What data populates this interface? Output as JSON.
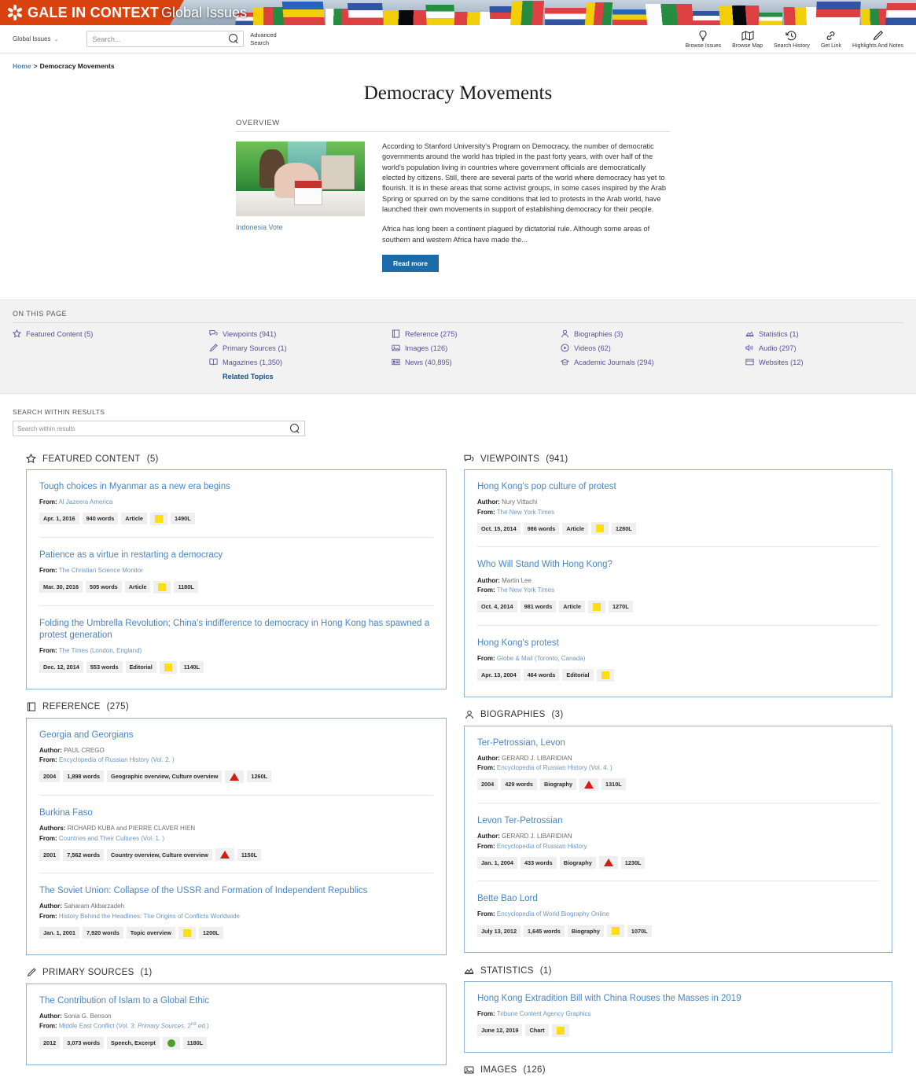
{
  "banner": {
    "brand": "GALE IN CONTEXT",
    "product": "Global Issues"
  },
  "toolbar": {
    "database_select": "Global Issues",
    "chevron": "⌄",
    "search_placeholder": "Search...",
    "search_value": "",
    "advanced_search": "Advanced Search",
    "tools": [
      {
        "label": "Browse Issues",
        "icon": "lightbulb-icon"
      },
      {
        "label": "Browse Map",
        "icon": "map-icon"
      },
      {
        "label": "Search History",
        "icon": "history-clock-icon"
      },
      {
        "label": "Get Link",
        "icon": "link-chain-icon"
      },
      {
        "label": "Highlights And Notes",
        "icon": "pencil-highlighter-icon"
      }
    ]
  },
  "breadcrumb": {
    "home": "Home",
    "separator": ">",
    "current": "Democracy Movements"
  },
  "page_title": "Democracy Movements",
  "overview": {
    "label": "OVERVIEW",
    "image_caption": "Indonesia Vote",
    "paragraph1": "According to Stanford University's Program on Democracy, the number of democratic governments around the world has tripled in the past forty years, with over half of the world's population living in countries where government officials are democratically elected by citizens. Still, there are several parts of the world where democracy has yet to flourish. It is in these areas that some activist groups, in some cases inspired by the Arab Spring or spurred on by the same conditions that led to protests in the Arab world, have launched their own movements in support of establishing democracy for their people.",
    "paragraph2": "Africa has long been a continent plagued by dictatorial rule. Although some areas of southern and western Africa have made the...",
    "read_more": "Read more"
  },
  "on_this_page": {
    "label": "ON THIS PAGE",
    "col1": [
      {
        "label": "Featured Content (5)",
        "icon": "star-icon"
      }
    ],
    "col2": [
      {
        "label": "Viewpoints (941)",
        "icon": "speech-bubbles-icon"
      },
      {
        "label": "Primary Sources (1)",
        "icon": "pencil-icon"
      },
      {
        "label": "Magazines (1,350)",
        "icon": "open-book-icon"
      }
    ],
    "related_topics": "Related Topics",
    "col3": [
      {
        "label": "Reference (275)",
        "icon": "book-icon"
      },
      {
        "label": "Images (126)",
        "icon": "picture-icon"
      },
      {
        "label": "News (40,895)",
        "icon": "newspaper-icon"
      }
    ],
    "col4": [
      {
        "label": "Biographies (3)",
        "icon": "person-icon"
      },
      {
        "label": "Videos (62)",
        "icon": "play-circle-icon"
      },
      {
        "label": "Academic Journals (294)",
        "icon": "graduation-cap-icon"
      }
    ],
    "col5": [
      {
        "label": "Statistics (1)",
        "icon": "chart-icon"
      },
      {
        "label": "Audio (297)",
        "icon": "speaker-icon"
      },
      {
        "label": "Websites (12)",
        "icon": "browser-window-icon"
      }
    ]
  },
  "search_within": {
    "label": "SEARCH WITHIN RESULTS",
    "placeholder": "Search within results",
    "value": ""
  },
  "sections": {
    "featured_content": {
      "title": "FEATURED CONTENT",
      "count": "(5)",
      "icon": "star-icon",
      "entries": [
        {
          "title": "Tough choices in Myanmar as a new era begins",
          "from_label": "From:",
          "from": "Al Jazeera America",
          "badges": [
            "Apr. 1, 2016",
            "940 words",
            "Article"
          ],
          "level": "yellow",
          "lexile": "1490L"
        },
        {
          "title": "Patience as a virtue in restarting a democracy",
          "from_label": "From:",
          "from": "The Christian Science Monitor",
          "badges": [
            "Mar. 30, 2016",
            "505 words",
            "Article"
          ],
          "level": "yellow",
          "lexile": "1180L"
        },
        {
          "title": "Folding the Umbrella Revolution; China's indifference to democracy in Hong Kong has spawned a protest generation",
          "from_label": "From:",
          "from": "The Times (London, England)",
          "badges": [
            "Dec. 12, 2014",
            "553 words",
            "Editorial"
          ],
          "level": "yellow",
          "lexile": "1140L"
        }
      ]
    },
    "viewpoints": {
      "title": "VIEWPOINTS",
      "count": "(941)",
      "icon": "speech-bubbles-icon",
      "entries": [
        {
          "title": "Hong Kong's pop culture of protest",
          "author_label": "Author:",
          "author": "Nury Vittachi",
          "from_label": "From:",
          "from": "The New York Times",
          "badges": [
            "Oct. 15, 2014",
            "986 words",
            "Article"
          ],
          "level": "yellow",
          "lexile": "1280L"
        },
        {
          "title": "Who Will Stand With Hong Kong?",
          "author_label": "Author:",
          "author": "Martin Lee",
          "from_label": "From:",
          "from": "The New York Times",
          "badges": [
            "Oct. 4, 2014",
            "981 words",
            "Article"
          ],
          "level": "yellow",
          "lexile": "1270L"
        },
        {
          "title": "Hong Kong's protest",
          "from_label": "From:",
          "from": "Globe & Mail (Toronto, Canada)",
          "badges": [
            "Apr. 13, 2004",
            "464 words",
            "Editorial"
          ],
          "level": "yellow",
          "lexile": ""
        }
      ]
    },
    "reference": {
      "title": "REFERENCE",
      "count": "(275)",
      "icon": "book-icon",
      "entries": [
        {
          "title": "Georgia and Georgians",
          "author_label": "Author:",
          "author": "PAUL CREGO",
          "from_label": "From:",
          "from": "Encyclopedia of Russian History (Vol. 2. )",
          "badges": [
            "2004",
            "1,898 words",
            "Geographic overview, Culture overview"
          ],
          "level": "red",
          "lexile": "1260L"
        },
        {
          "title": "Burkina Faso",
          "author_label": "Authors:",
          "author": "RICHARD KUBA and PIERRE CLAVER HIEN",
          "from_label": "From:",
          "from": "Countries and Their Cultures (Vol. 1. )",
          "badges": [
            "2001",
            "7,562 words",
            "Country overview, Culture overview"
          ],
          "level": "red",
          "lexile": "1150L"
        },
        {
          "title": "The Soviet Union: Collapse of the USSR and Formation of Independent Republics",
          "author_label": "Author:",
          "author": "Saharam Akbarzadeh",
          "from_label": "From:",
          "from": "History Behind the Headlines: The Origins of Conflicts Worldwide",
          "badges": [
            "Jan. 1, 2001",
            "7,920 words",
            "Topic overview"
          ],
          "level": "yellow",
          "lexile": "1200L"
        }
      ]
    },
    "biographies": {
      "title": "BIOGRAPHIES",
      "count": "(3)",
      "icon": "person-icon",
      "entries": [
        {
          "title": "Ter-Petrossian, Levon",
          "author_label": "Author:",
          "author": "GERARD J. LIBARIDIAN",
          "from_label": "From:",
          "from": "Encyclopedia of Russian History (Vol. 4. )",
          "badges": [
            "2004",
            "429 words",
            "Biography"
          ],
          "level": "red",
          "lexile": "1310L"
        },
        {
          "title": "Levon Ter-Petrossian",
          "author_label": "Author:",
          "author": "GERARD J. LIBARIDIAN",
          "from_label": "From:",
          "from": "Encyclopedia of Russian History",
          "badges": [
            "Jan. 1, 2004",
            "433 words",
            "Biography"
          ],
          "level": "red",
          "lexile": "1230L"
        },
        {
          "title": "Bette Bao Lord",
          "from_label": "From:",
          "from": "Encyclopedia of World Biography Online",
          "badges": [
            "July 13, 2012",
            "1,645 words",
            "Biography"
          ],
          "level": "yellow",
          "lexile": "1070L"
        }
      ]
    },
    "primary_sources": {
      "title": "PRIMARY SOURCES",
      "count": "(1)",
      "icon": "pencil-icon",
      "entries": [
        {
          "title": "The Contribution of Islam to a Global Ethic",
          "author_label": "Author:",
          "author": "Sonia G. Benson",
          "from_label": "From:",
          "from_plain": "Middle East Conflict",
          "from_suffix_pre": " (Vol. 3: ",
          "from_suffix_em": "Primary Sources",
          "from_suffix_post": ". 2",
          "from_suffix_sup": "nd",
          "from_suffix_end": " ed.)",
          "badges": [
            "2012",
            "3,073 words",
            "Speech, Excerpt"
          ],
          "level": "green",
          "lexile": "1180L"
        }
      ]
    },
    "statistics": {
      "title": "STATISTICS",
      "count": "(1)",
      "icon": "chart-icon",
      "entries": [
        {
          "title": "Hong Kong Extradition Bill with China Rouses the Masses in 2019",
          "from_label": "From:",
          "from": "Tribune Content Agency Graphics",
          "badges": [
            "June 12, 2019",
            "Chart"
          ],
          "level": "yellow",
          "lexile": ""
        }
      ]
    },
    "images": {
      "title": "IMAGES",
      "count": "(126)",
      "icon": "picture-icon"
    }
  },
  "colors": {
    "brand_orange": "#d9430f",
    "link_blue": "#4a86c5",
    "otp_purple": "#5b4d9c",
    "button_blue": "#1b6ca8",
    "card_border": "#8fb4cc",
    "level_yellow": "#ffdd14",
    "level_green": "#4f9d28",
    "level_red": "#cf1f18"
  }
}
